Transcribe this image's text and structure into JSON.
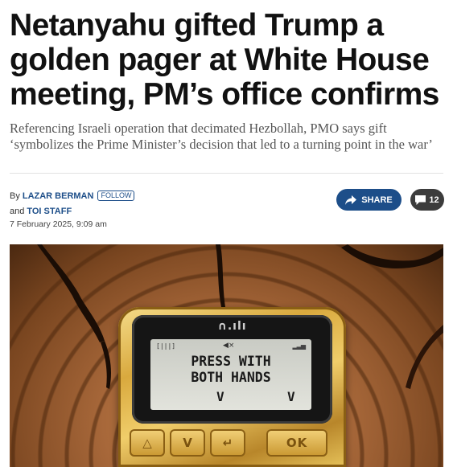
{
  "article": {
    "headline": "Netanyahu gifted Trump a golden pager at White House meeting, PM’s office confirms",
    "subhead": "Referencing Israeli operation that decimated Hezbollah, PMO says gift ‘symbolizes the Prime Minister’s decision that led to a turning point in the war’",
    "byline": {
      "by_prefix": "By",
      "author": "Lazar Berman",
      "follow_label": "FOLLOW",
      "and_prefix": "and",
      "coauthor": "TOI Staff",
      "date": "7 February 2025, 9:09 am"
    },
    "actions": {
      "share_label": "SHARE",
      "share_icon": "share-arrow-icon",
      "comments_count": "12",
      "comments_icon": "comment-bubble-icon"
    }
  },
  "photo": {
    "pager": {
      "brand": "∩.ılı",
      "status_battery": "[|||]",
      "status_mute": "◀×",
      "status_signal": "▂▃▅",
      "message": "PRESS WITH\nBOTH HANDS",
      "arrow_left": "V",
      "arrow_right": "V",
      "keys": [
        "△",
        "V",
        "↵",
        "OK"
      ]
    }
  }
}
